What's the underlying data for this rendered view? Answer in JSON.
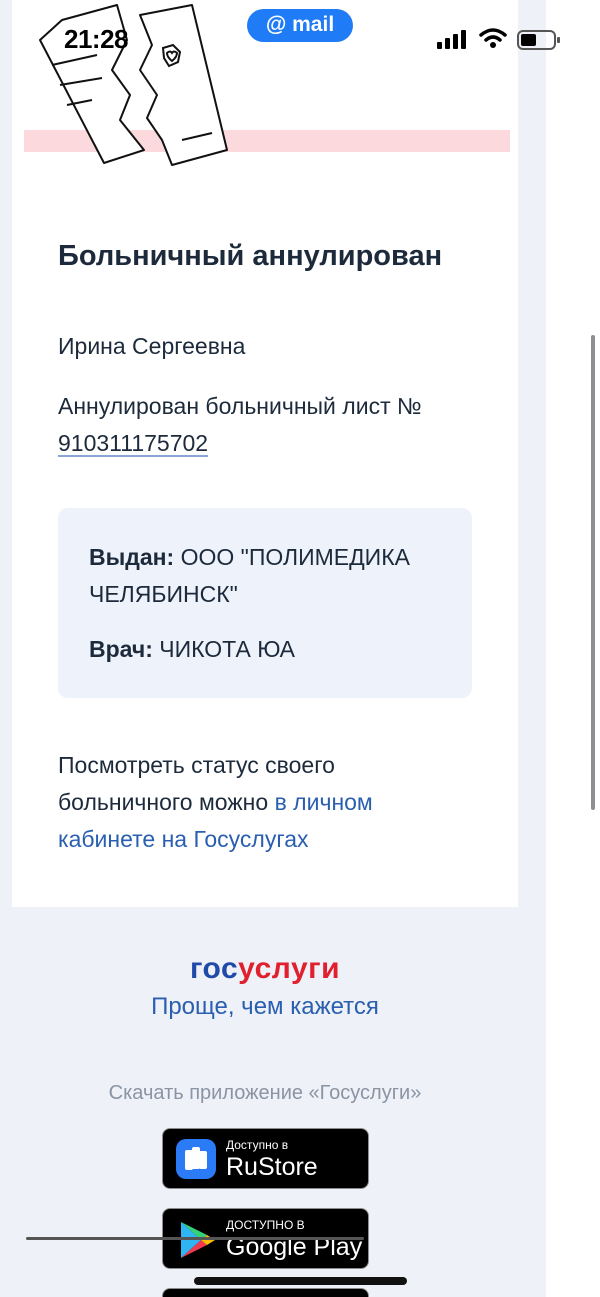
{
  "status_bar": {
    "time": "21:28",
    "app_pill": "@ mail"
  },
  "email": {
    "title": "Больничный аннулирован",
    "greeting": "Ирина Сергеевна",
    "notice_text": "Аннулирован больничный лист №",
    "sick_leave_number": "910311175702",
    "issued_by_label": "Выдан:",
    "issued_by_value": "ООО \"ПОЛИМЕДИКА ЧЕЛЯБИНСК\"",
    "doctor_label": "Врач:",
    "doctor_value": "ЧИКОТА ЮА",
    "status_text": "Посмотреть статус своего больничного можно",
    "status_link": "в личном кабинете на Госуслугах"
  },
  "footer": {
    "brand_part1": "гос",
    "brand_part2": "услуги",
    "slogan": "Проще, чем кажется",
    "download_text": "Скачать приложение «Госуслуги»",
    "rustore_small": "Доступно в",
    "rustore_big": "RuStore",
    "googleplay_small": "ДОСТУПНО В",
    "googleplay_big": "Google Play"
  },
  "colors": {
    "brand_blue": "#1f4aa8",
    "brand_red": "#e0202e",
    "link": "#2a5fb0",
    "info_box_bg": "#edf2fb",
    "pill": "#1f7cf6"
  }
}
